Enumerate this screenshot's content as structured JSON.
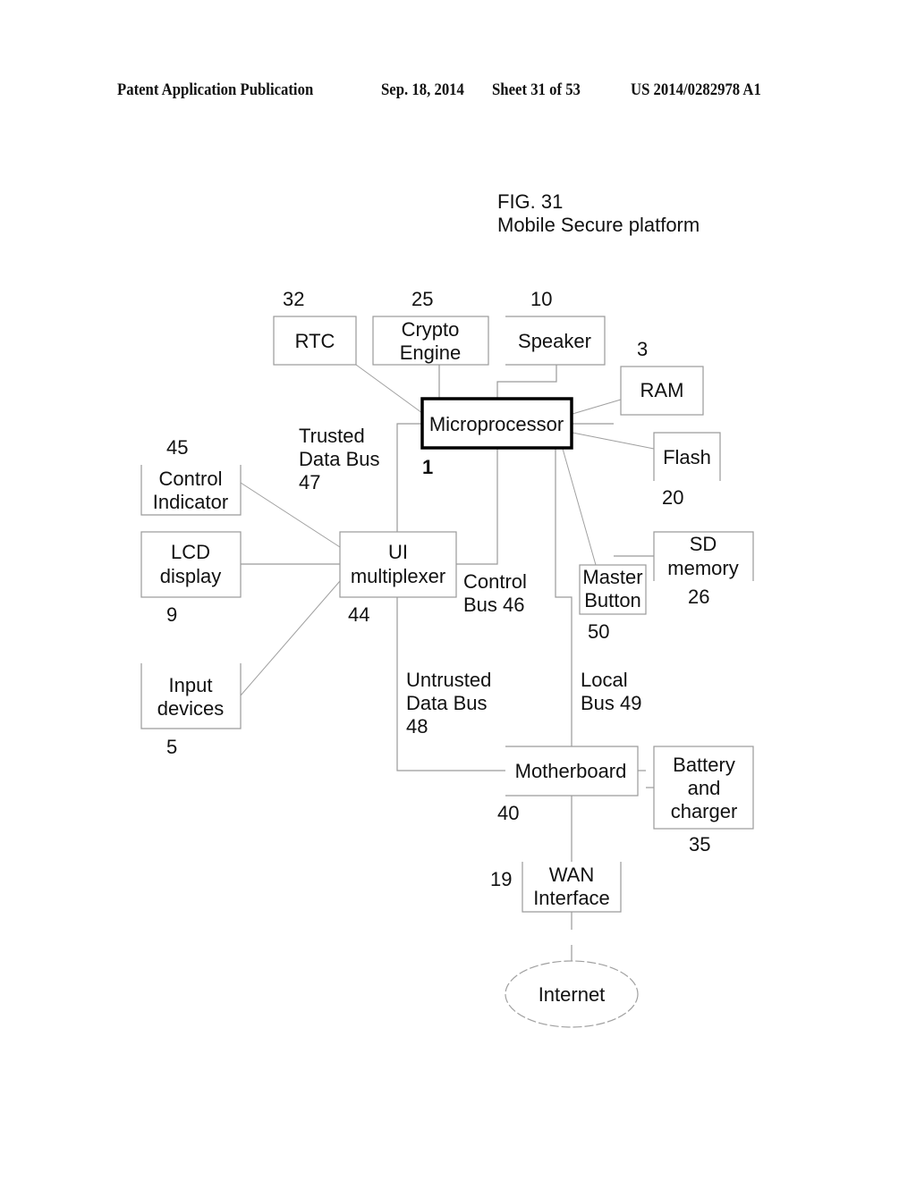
{
  "header": {
    "publication": "Patent Application Publication",
    "date": "Sep. 18, 2014",
    "sheet": "Sheet 31 of 53",
    "number": "US 2014/0282978 A1"
  },
  "figure": {
    "number": "FIG. 31",
    "title": "Mobile Secure platform"
  },
  "components": {
    "rtc": {
      "label": "RTC",
      "ref": "32"
    },
    "crypto": {
      "line1": "Crypto",
      "line2": "Engine",
      "ref": "25"
    },
    "speaker": {
      "label": "Speaker",
      "ref": "10"
    },
    "ram": {
      "label": "RAM",
      "ref": "3"
    },
    "microprocessor": {
      "label": "Microprocessor",
      "ref": "1"
    },
    "flash": {
      "label": "Flash",
      "ref": "20"
    },
    "control_indicator": {
      "line1": "Control",
      "line2": "Indicator",
      "ref": "45"
    },
    "lcd": {
      "line1": "LCD",
      "line2": "display",
      "ref": "9"
    },
    "ui_mux": {
      "line1": "UI",
      "line2": "multiplexer",
      "ref": "44"
    },
    "input": {
      "line1": "Input",
      "line2": "devices",
      "ref": "5"
    },
    "sd": {
      "line1": "SD",
      "line2": "memory",
      "ref": "26"
    },
    "master": {
      "line1": "Master",
      "line2": "Button",
      "ref": "50"
    },
    "motherboard": {
      "label": "Motherboard",
      "ref": "40"
    },
    "battery": {
      "line1": "Battery",
      "line2": "and",
      "line3": "charger",
      "ref": "35"
    },
    "wan": {
      "line1": "WAN",
      "line2": "Interface",
      "ref": "19"
    },
    "internet": {
      "label": "Internet"
    }
  },
  "buses": {
    "trusted": {
      "line1": "Trusted",
      "line2": "Data Bus",
      "line3": "47"
    },
    "control": {
      "line1": "Control",
      "line2": "Bus 46"
    },
    "untrusted": {
      "line1": "Untrusted",
      "line2": "Data Bus",
      "line3": "48"
    },
    "local": {
      "line1": "Local",
      "line2": "Bus 49"
    }
  }
}
